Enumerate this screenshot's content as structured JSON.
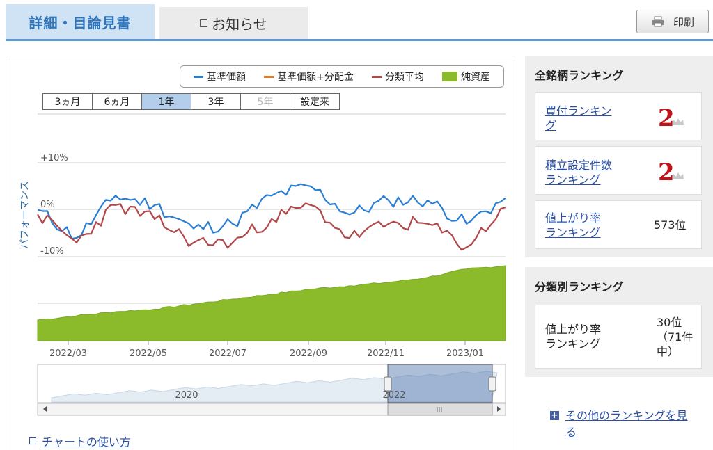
{
  "tabs": {
    "detail_label": "詳細・目論見書",
    "news_label": "お知らせ"
  },
  "toolbar": {
    "print_label": "印刷"
  },
  "chart": {
    "legend": [
      {
        "label": "基準価額",
        "color": "#2a7fd4"
      },
      {
        "label": "基準価額+分配金",
        "color": "#e07b2a"
      },
      {
        "label": "分類平均",
        "color": "#b2474a"
      },
      {
        "label": "純資産",
        "color": "#8bbb2a"
      }
    ],
    "periods": [
      {
        "label": "3ヵ月",
        "state": "normal"
      },
      {
        "label": "6ヵ月",
        "state": "normal"
      },
      {
        "label": "1年",
        "state": "selected"
      },
      {
        "label": "3年",
        "state": "normal"
      },
      {
        "label": "5年",
        "state": "disabled"
      },
      {
        "label": "設定来",
        "state": "normal"
      }
    ],
    "help_link": "チャートの使い方"
  },
  "chart_data": {
    "type": "line",
    "ylabel": "パフォーマンス",
    "y_ticks": [
      "+10%",
      "0%",
      "-10%"
    ],
    "ylim": [
      -10,
      10
    ],
    "x_ticks": [
      "2022/03",
      "2022/05",
      "2022/07",
      "2022/09",
      "2022/11",
      "2023/01"
    ],
    "x": [
      "2022/02",
      "2022/03",
      "2022/04",
      "2022/05",
      "2022/06",
      "2022/07",
      "2022/08",
      "2022/09",
      "2022/10",
      "2022/11",
      "2022/12",
      "2023/01",
      "2023/02"
    ],
    "series": [
      {
        "name": "基準価額",
        "values": [
          0,
          -6,
          3,
          1,
          -4,
          -3,
          3,
          5,
          -1,
          2,
          2,
          -3,
          2.5
        ]
      },
      {
        "name": "分類平均",
        "values": [
          -1,
          -7,
          1,
          -2,
          -7,
          -7,
          -2,
          1,
          -6,
          -3,
          -3,
          -8,
          0.5
        ]
      },
      {
        "name": "純資産",
        "values": [
          25,
          30,
          35,
          38,
          44,
          50,
          56,
          62,
          66,
          70,
          76,
          86,
          90
        ]
      }
    ],
    "navigator": {
      "x_ticks": [
        "2020",
        "2022"
      ]
    }
  },
  "ranking_all": {
    "title": "全銘柄ランキング",
    "items": [
      {
        "label_lines": [
          "買付ランキン",
          "グ"
        ],
        "rank": "2"
      },
      {
        "label_lines": [
          "積立設定件数",
          "ランキング"
        ],
        "rank": "2"
      },
      {
        "label_lines": [
          "値上がり率",
          "ランキング"
        ],
        "rank": "573位"
      }
    ]
  },
  "ranking_category": {
    "title": "分類別ランキング",
    "item": {
      "label_lines": [
        "値上がり率",
        "ランキング"
      ],
      "rank_lines": [
        "30位",
        "（71件",
        "中）"
      ]
    }
  },
  "other_ranking": {
    "label_lines": [
      "その他のランキングを見",
      "る"
    ]
  },
  "colors": {
    "accent": "#2f73b8",
    "link": "#2a4fa3",
    "rank_red": "#c0141a",
    "net_assets": "#8bbb2a"
  }
}
